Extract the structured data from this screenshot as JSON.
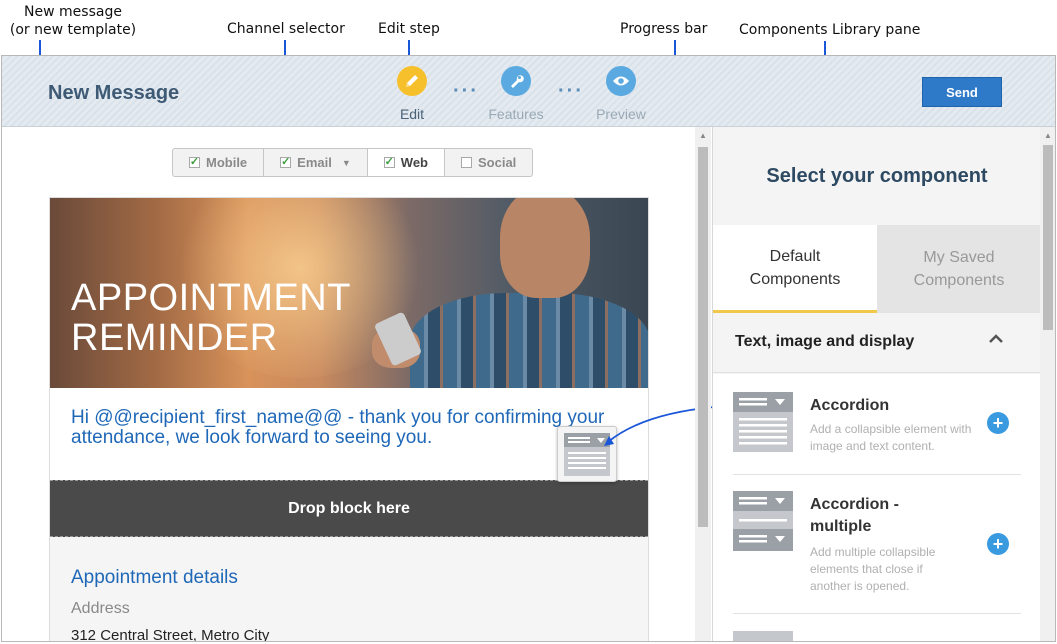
{
  "annotations": {
    "new_message": "New message\n(or new template)",
    "channel_selector": "Channel selector",
    "edit_step": "Edit step",
    "progress_bar": "Progress bar",
    "library_pane": "Components Library pane"
  },
  "header": {
    "title": "New Message",
    "steps": [
      {
        "label": "Edit",
        "icon": "pencil-icon",
        "color": "#f5c02c"
      },
      {
        "label": "Features",
        "icon": "wrench-icon",
        "color": "#5aa9e0"
      },
      {
        "label": "Preview",
        "icon": "eye-icon",
        "color": "#5aa9e0"
      }
    ],
    "send_label": "Send"
  },
  "channels": [
    {
      "label": "Mobile",
      "checked": true
    },
    {
      "label": "Email",
      "checked": true
    },
    {
      "label": "Web",
      "checked": true
    },
    {
      "label": "Social",
      "checked": false
    }
  ],
  "email": {
    "hero_title_line1": "APPOINTMENT",
    "hero_title_line2": "REMINDER",
    "greeting": "Hi @@recipient_first_name@@ - thank you for confirming your attendance, we look forward to seeing you.",
    "drop_label": "Drop block here",
    "details_heading": "Appointment details",
    "address_label": "Address",
    "address_value": "312 Central Street, Metro City"
  },
  "library": {
    "title": "Select your component",
    "tabs": [
      {
        "label": "Default Components",
        "active": true
      },
      {
        "label": "My Saved Components",
        "active": false
      }
    ],
    "section_title": "Text, image and display",
    "items": [
      {
        "name": "Accordion",
        "desc": "Add a collapsible element with image and text content."
      },
      {
        "name": "Accordion - multiple",
        "desc": "Add multiple collapsible elements that close if another is opened."
      }
    ]
  },
  "colors": {
    "accent_blue": "#2f7ac8",
    "edit_yellow": "#f5c02c",
    "link_blue": "#1f68b8",
    "annotation_blue": "#1a56d8"
  }
}
